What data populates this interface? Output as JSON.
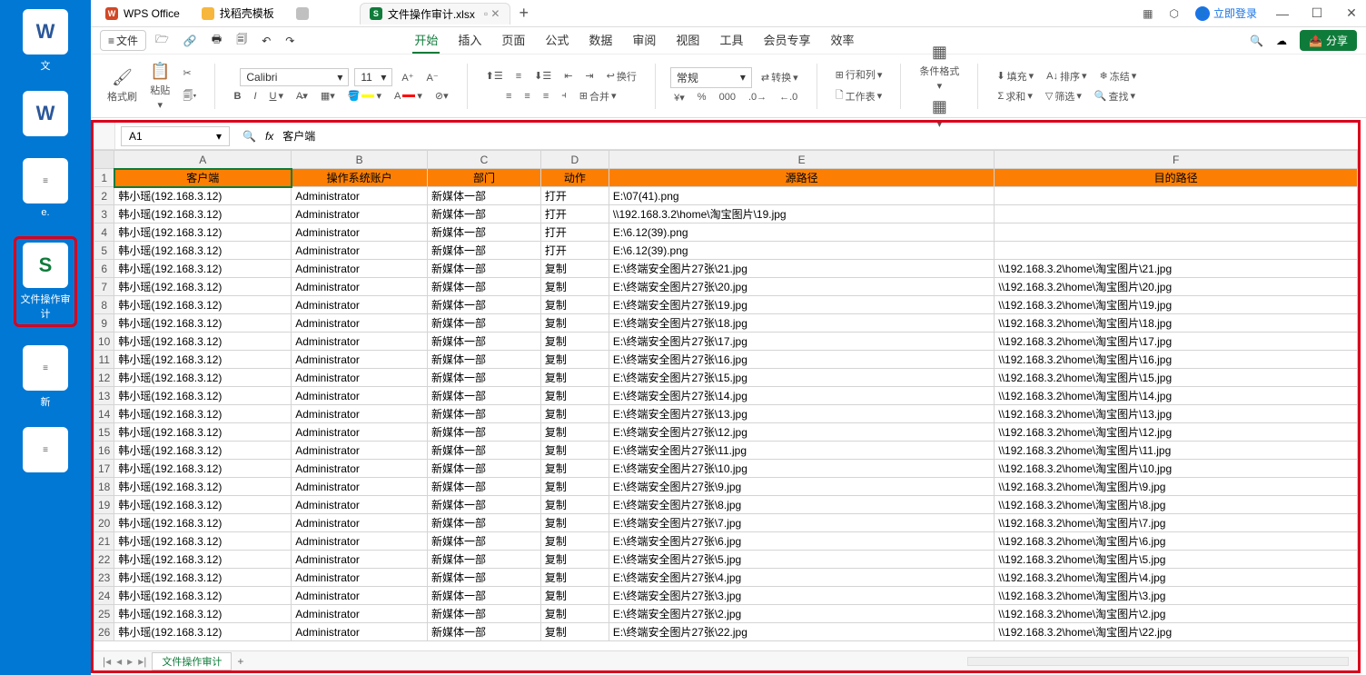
{
  "desktop": {
    "icons": [
      {
        "glyph": "W",
        "label": "文",
        "cls": ""
      },
      {
        "glyph": "W",
        "label": "",
        "cls": ""
      },
      {
        "glyph": "≡",
        "label": "e.",
        "cls": "paper"
      },
      {
        "glyph": "S",
        "label": "文件操作审计",
        "cls": "green"
      },
      {
        "glyph": "≡",
        "label": "新",
        "cls": "paper"
      },
      {
        "glyph": "≡",
        "label": "",
        "cls": "paper"
      }
    ]
  },
  "titlebar": {
    "tabs": [
      {
        "icon": "red",
        "text": "WPS Office"
      },
      {
        "icon": "yellow",
        "text": "找稻壳模板"
      },
      {
        "icon": "blur",
        "text": "　　　"
      },
      {
        "icon": "green",
        "text": "文件操作审计.xlsx",
        "active": true
      }
    ],
    "login": "立即登录"
  },
  "menubar": {
    "file": "文件",
    "tabs": [
      "开始",
      "插入",
      "页面",
      "公式",
      "数据",
      "审阅",
      "视图",
      "工具",
      "会员专享",
      "效率"
    ],
    "active": 0,
    "share": "分享"
  },
  "ribbon": {
    "format_brush": "格式刷",
    "paste": "粘贴",
    "font": "Calibri",
    "size": "11",
    "wrap": "换行",
    "merge": "合并",
    "number_fmt": "常规",
    "convert": "转换",
    "rowcol": "行和列",
    "sheet": "工作表",
    "cond": "条件格式",
    "fill": "填充",
    "sort": "排序",
    "freeze": "冻结",
    "sum": "求和",
    "filter": "筛选",
    "find": "查找"
  },
  "formula": {
    "cell": "A1",
    "fx": "fx",
    "value": "客户端"
  },
  "sheet": {
    "columns": [
      "A",
      "B",
      "C",
      "D",
      "E",
      "F"
    ],
    "header": [
      "客户端",
      "操作系统账户",
      "部门",
      "动作",
      "源路径",
      "目的路径"
    ],
    "rows": [
      [
        "韩小瑶(192.168.3.12)",
        "Administrator",
        "新媒体一部",
        "打开",
        "E:\\07(41).png",
        ""
      ],
      [
        "韩小瑶(192.168.3.12)",
        "Administrator",
        "新媒体一部",
        "打开",
        "\\\\192.168.3.2\\home\\淘宝图片\\19.jpg",
        ""
      ],
      [
        "韩小瑶(192.168.3.12)",
        "Administrator",
        "新媒体一部",
        "打开",
        "E:\\6.12(39).png",
        ""
      ],
      [
        "韩小瑶(192.168.3.12)",
        "Administrator",
        "新媒体一部",
        "打开",
        "E:\\6.12(39).png",
        ""
      ],
      [
        "韩小瑶(192.168.3.12)",
        "Administrator",
        "新媒体一部",
        "复制",
        "E:\\终端安全图片27张\\21.jpg",
        "\\\\192.168.3.2\\home\\淘宝图片\\21.jpg"
      ],
      [
        "韩小瑶(192.168.3.12)",
        "Administrator",
        "新媒体一部",
        "复制",
        "E:\\终端安全图片27张\\20.jpg",
        "\\\\192.168.3.2\\home\\淘宝图片\\20.jpg"
      ],
      [
        "韩小瑶(192.168.3.12)",
        "Administrator",
        "新媒体一部",
        "复制",
        "E:\\终端安全图片27张\\19.jpg",
        "\\\\192.168.3.2\\home\\淘宝图片\\19.jpg"
      ],
      [
        "韩小瑶(192.168.3.12)",
        "Administrator",
        "新媒体一部",
        "复制",
        "E:\\终端安全图片27张\\18.jpg",
        "\\\\192.168.3.2\\home\\淘宝图片\\18.jpg"
      ],
      [
        "韩小瑶(192.168.3.12)",
        "Administrator",
        "新媒体一部",
        "复制",
        "E:\\终端安全图片27张\\17.jpg",
        "\\\\192.168.3.2\\home\\淘宝图片\\17.jpg"
      ],
      [
        "韩小瑶(192.168.3.12)",
        "Administrator",
        "新媒体一部",
        "复制",
        "E:\\终端安全图片27张\\16.jpg",
        "\\\\192.168.3.2\\home\\淘宝图片\\16.jpg"
      ],
      [
        "韩小瑶(192.168.3.12)",
        "Administrator",
        "新媒体一部",
        "复制",
        "E:\\终端安全图片27张\\15.jpg",
        "\\\\192.168.3.2\\home\\淘宝图片\\15.jpg"
      ],
      [
        "韩小瑶(192.168.3.12)",
        "Administrator",
        "新媒体一部",
        "复制",
        "E:\\终端安全图片27张\\14.jpg",
        "\\\\192.168.3.2\\home\\淘宝图片\\14.jpg"
      ],
      [
        "韩小瑶(192.168.3.12)",
        "Administrator",
        "新媒体一部",
        "复制",
        "E:\\终端安全图片27张\\13.jpg",
        "\\\\192.168.3.2\\home\\淘宝图片\\13.jpg"
      ],
      [
        "韩小瑶(192.168.3.12)",
        "Administrator",
        "新媒体一部",
        "复制",
        "E:\\终端安全图片27张\\12.jpg",
        "\\\\192.168.3.2\\home\\淘宝图片\\12.jpg"
      ],
      [
        "韩小瑶(192.168.3.12)",
        "Administrator",
        "新媒体一部",
        "复制",
        "E:\\终端安全图片27张\\11.jpg",
        "\\\\192.168.3.2\\home\\淘宝图片\\11.jpg"
      ],
      [
        "韩小瑶(192.168.3.12)",
        "Administrator",
        "新媒体一部",
        "复制",
        "E:\\终端安全图片27张\\10.jpg",
        "\\\\192.168.3.2\\home\\淘宝图片\\10.jpg"
      ],
      [
        "韩小瑶(192.168.3.12)",
        "Administrator",
        "新媒体一部",
        "复制",
        "E:\\终端安全图片27张\\9.jpg",
        "\\\\192.168.3.2\\home\\淘宝图片\\9.jpg"
      ],
      [
        "韩小瑶(192.168.3.12)",
        "Administrator",
        "新媒体一部",
        "复制",
        "E:\\终端安全图片27张\\8.jpg",
        "\\\\192.168.3.2\\home\\淘宝图片\\8.jpg"
      ],
      [
        "韩小瑶(192.168.3.12)",
        "Administrator",
        "新媒体一部",
        "复制",
        "E:\\终端安全图片27张\\7.jpg",
        "\\\\192.168.3.2\\home\\淘宝图片\\7.jpg"
      ],
      [
        "韩小瑶(192.168.3.12)",
        "Administrator",
        "新媒体一部",
        "复制",
        "E:\\终端安全图片27张\\6.jpg",
        "\\\\192.168.3.2\\home\\淘宝图片\\6.jpg"
      ],
      [
        "韩小瑶(192.168.3.12)",
        "Administrator",
        "新媒体一部",
        "复制",
        "E:\\终端安全图片27张\\5.jpg",
        "\\\\192.168.3.2\\home\\淘宝图片\\5.jpg"
      ],
      [
        "韩小瑶(192.168.3.12)",
        "Administrator",
        "新媒体一部",
        "复制",
        "E:\\终端安全图片27张\\4.jpg",
        "\\\\192.168.3.2\\home\\淘宝图片\\4.jpg"
      ],
      [
        "韩小瑶(192.168.3.12)",
        "Administrator",
        "新媒体一部",
        "复制",
        "E:\\终端安全图片27张\\3.jpg",
        "\\\\192.168.3.2\\home\\淘宝图片\\3.jpg"
      ],
      [
        "韩小瑶(192.168.3.12)",
        "Administrator",
        "新媒体一部",
        "复制",
        "E:\\终端安全图片27张\\2.jpg",
        "\\\\192.168.3.2\\home\\淘宝图片\\2.jpg"
      ],
      [
        "韩小瑶(192.168.3.12)",
        "Administrator",
        "新媒体一部",
        "复制",
        "E:\\终端安全图片27张\\22.jpg",
        "\\\\192.168.3.2\\home\\淘宝图片\\22.jpg"
      ]
    ],
    "tab": "文件操作审计"
  }
}
